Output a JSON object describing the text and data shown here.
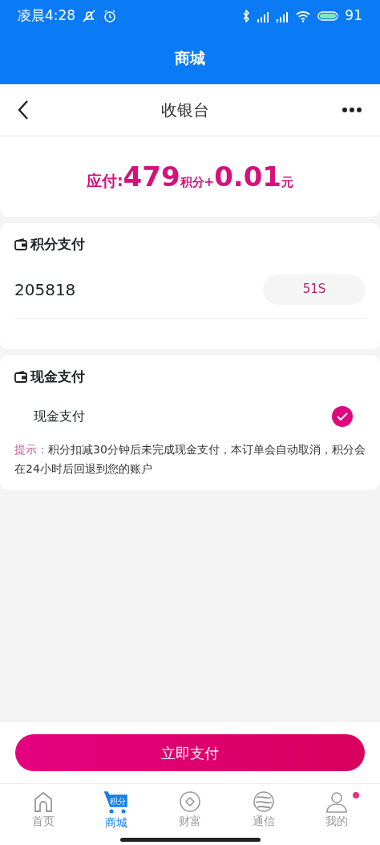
{
  "status_bar": {
    "time": "凌晨4:28",
    "battery": "91"
  },
  "app_header": {
    "title": "商城"
  },
  "nav": {
    "title": "收银台"
  },
  "amount": {
    "parts": [
      {
        "kind": "label",
        "text": "应付:"
      },
      {
        "kind": "number",
        "text": "479"
      },
      {
        "kind": "unit",
        "text": "积分"
      },
      {
        "kind": "unit",
        "text": "+"
      },
      {
        "kind": "number",
        "text": "0.01"
      },
      {
        "kind": "unit",
        "text": "元"
      }
    ]
  },
  "points_payment": {
    "title": "积分支付",
    "code": "205818",
    "countdown": "51S"
  },
  "cash_payment": {
    "title": "现金支付",
    "option": {
      "label": "现金支付",
      "checked": true
    },
    "tip_label": "提示：",
    "tip": "积分扣减30分钟后未完成现金支付，本订单会自动取消，积分会在24小时后回退到您的账户"
  },
  "pay_button": "立即支付",
  "tab_bar": [
    {
      "kind": "home",
      "label": "首页",
      "selected": false,
      "badge": false
    },
    {
      "kind": "mall",
      "label": "商城",
      "icon_text": "积分",
      "selected": true,
      "badge": false
    },
    {
      "kind": "wealth",
      "label": "财富",
      "selected": false,
      "badge": false
    },
    {
      "kind": "telecom",
      "label": "通信",
      "selected": false,
      "badge": false
    },
    {
      "kind": "me",
      "label": "我的",
      "selected": false,
      "badge": true
    }
  ]
}
